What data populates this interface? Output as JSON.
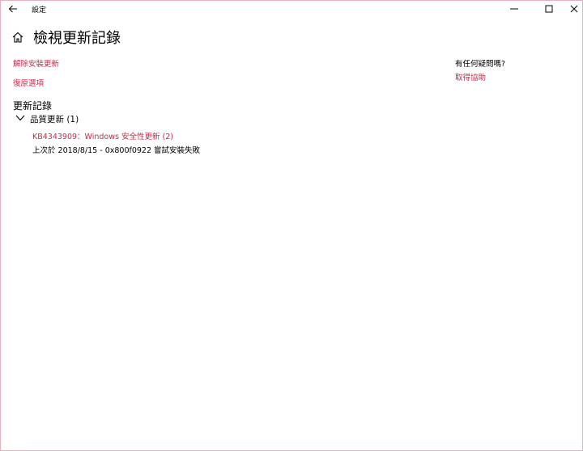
{
  "window": {
    "title": "設定"
  },
  "page": {
    "title": "檢視更新記錄"
  },
  "links": {
    "uninstall": "解除安裝更新",
    "recovery": "復原選項"
  },
  "help": {
    "question": "有任何疑問嗎?",
    "link": "取得協助"
  },
  "history": {
    "heading": "更新記錄",
    "groups": [
      {
        "label": "品質更新 (1)",
        "items": [
          {
            "title": "KB4343909：Windows 安全性更新 (2)",
            "status": "上次於 2018/8/15 - 0x800f0922 嘗試安裝失敗"
          }
        ]
      }
    ]
  },
  "colors": {
    "accent": "#c42b4b",
    "border": "#e3b3bb"
  }
}
